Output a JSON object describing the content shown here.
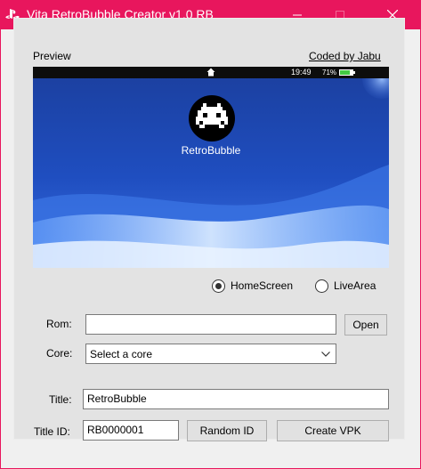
{
  "window": {
    "title": "Vita RetroBubble Creator v1.0 RB",
    "accent_color": "#e8165d"
  },
  "preview": {
    "label": "Preview",
    "credit": "Coded by Jabu",
    "status_time": "19:49",
    "battery_percent": "71%",
    "app_name": "RetroBubble"
  },
  "options": {
    "homescreen_label": "HomeScreen",
    "livearea_label": "LiveArea",
    "selected": "HomeScreen"
  },
  "form": {
    "rom_label": "Rom:",
    "rom_value": "",
    "open_label": "Open",
    "core_label": "Core:",
    "core_value": "Select a core",
    "title_label": "Title:",
    "title_value": "RetroBubble",
    "titleid_label": "Title ID:",
    "titleid_value": "RB0000001",
    "random_label": "Random ID",
    "create_label": "Create VPK"
  }
}
